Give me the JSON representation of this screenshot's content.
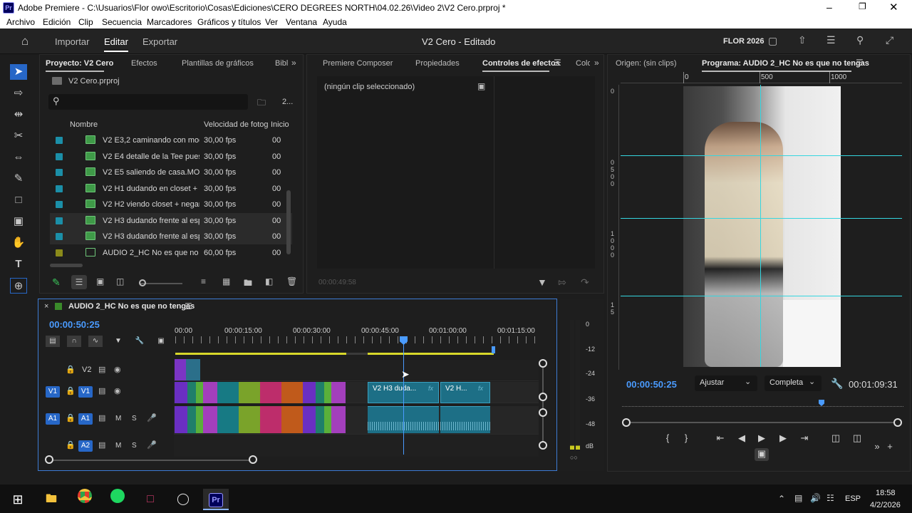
{
  "window": {
    "title": "Adobe Premiere - C:\\Usuarios\\Flor owo\\Escritorio\\Cosas\\Ediciones\\CERO DEGREES NORTH\\04.02.26\\Video 2\\V2 Cero.prproj *",
    "app_badge": "Pr"
  },
  "menu": [
    "Archivo",
    "Edición",
    "Clip",
    "Secuencia",
    "Marcadores",
    "Gráficos y títulos",
    "Ver",
    "Ventana",
    "Ayuda"
  ],
  "workspace": {
    "tabs": [
      "Importar",
      "Editar",
      "Exportar"
    ],
    "active": "Editar",
    "doc_title": "V2 Cero - Editado",
    "user_label": "FLOR 2026"
  },
  "project_panel": {
    "tabs": [
      "Proyecto: V2 Cero",
      "Efectos",
      "Plantillas de gráficos",
      "Bibl"
    ],
    "file": "V2 Cero.prproj",
    "item_count": "2...",
    "search_placeholder": "",
    "columns": [
      "Nombre",
      "Velocidad de fotogr",
      "Inicio"
    ],
    "items": [
      {
        "name": "V2 E3,2 caminando con moc",
        "fps": "30,00 fps",
        "start": "00",
        "color": "#1b8fa8",
        "type": "video",
        "sel": false
      },
      {
        "name": "V2 E4 detalle de la Tee puest",
        "fps": "30,00 fps",
        "start": "00",
        "color": "#1b8fa8",
        "type": "video",
        "sel": false
      },
      {
        "name": "V2 E5 saliendo de casa.MOV",
        "fps": "30,00 fps",
        "start": "00",
        "color": "#1b8fa8",
        "type": "video",
        "sel": false
      },
      {
        "name": "V2 H1 dudando en closet + s",
        "fps": "30,00 fps",
        "start": "00",
        "color": "#1b8fa8",
        "type": "video",
        "sel": false
      },
      {
        "name": "V2 H2 viendo closet + negan",
        "fps": "30,00 fps",
        "start": "00",
        "color": "#1b8fa8",
        "type": "video",
        "sel": false
      },
      {
        "name": "V2 H3 dudando frente al esp",
        "fps": "30,00 fps",
        "start": "00",
        "color": "#1b8fa8",
        "type": "video",
        "sel": true
      },
      {
        "name": "V2 H3 dudando frente al esp",
        "fps": "30,00 fps",
        "start": "00",
        "color": "#1b8fa8",
        "type": "video",
        "sel": true
      },
      {
        "name": "AUDIO 2_HC No es que no t",
        "fps": "60,00 fps",
        "start": "00",
        "color": "#8a8a1a",
        "type": "sequence",
        "sel": false
      }
    ]
  },
  "effects_panel": {
    "tabs": [
      "Premiere Composer",
      "Propiedades",
      "Controles de efectos",
      "Colo"
    ],
    "no_clip": "(ningún clip seleccionado)",
    "timecode": "00:00:49:58"
  },
  "source_panel": {
    "label": "Origen: (sin clips)"
  },
  "program_panel": {
    "title": "Programa: AUDIO 2_HC No es que no tengas",
    "ruler": [
      "0",
      "500",
      "1000"
    ],
    "timecode": "00:00:50:25",
    "fit": "Ajustar",
    "quality": "Completa",
    "duration": "00:01:09:31",
    "left_ruler": [
      "0",
      "0",
      "5",
      "0",
      "0",
      "1",
      "0",
      "0",
      "0",
      "1",
      "5"
    ]
  },
  "timeline": {
    "sequence": "AUDIO 2_HC No es que no tengas",
    "timecode": "00:00:50:25",
    "ruler": [
      "00:00",
      "00:00:15:00",
      "00:00:30:00",
      "00:00:45:00",
      "00:01:00:00",
      "00:01:15:00"
    ],
    "tracks": {
      "v2": "V2",
      "v1": "V1",
      "a1": "A1",
      "a2": "A2",
      "m": "M",
      "s": "S"
    },
    "clip1": "V2 H3 duda...",
    "clip2": "V2 H...",
    "fx": "fx"
  },
  "meter": {
    "labels": [
      "0",
      "-12",
      "-24",
      "-36",
      "-48",
      "dB"
    ]
  },
  "taskbar": {
    "time": "18:58",
    "date": "4/2/2026",
    "lang": "ESP"
  }
}
